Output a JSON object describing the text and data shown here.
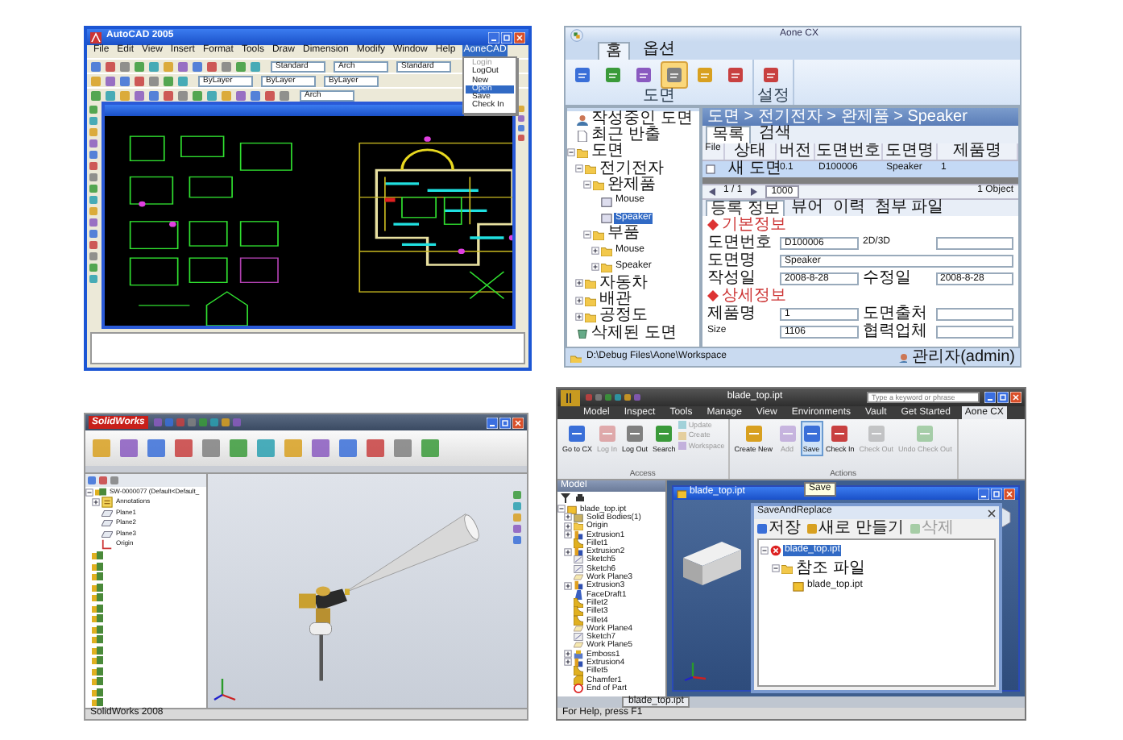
{
  "screens": [
    {
      "kind": "autocad",
      "title": "AutoCAD 2005",
      "menu": [
        {
          "label": "File",
          "selected": false
        },
        {
          "label": "Edit",
          "selected": false
        },
        {
          "label": "View",
          "selected": false
        },
        {
          "label": "Insert",
          "selected": false
        },
        {
          "label": "Format",
          "selected": false
        },
        {
          "label": "Tools",
          "selected": false
        },
        {
          "label": "Draw",
          "selected": false
        },
        {
          "label": "Dimension",
          "selected": false
        },
        {
          "label": "Modify",
          "selected": false
        },
        {
          "label": "Window",
          "selected": false
        },
        {
          "label": "Help",
          "selected": false
        },
        {
          "label": "AoneCAD",
          "selected": true
        }
      ],
      "dropdown": [
        {
          "label": "Login",
          "disabled": true,
          "selected": false
        },
        {
          "label": "LogOut",
          "disabled": false,
          "selected": false
        },
        {
          "label": "New",
          "disabled": false,
          "selected": false
        },
        {
          "label": "Open",
          "disabled": false,
          "selected": true
        },
        {
          "label": "Save",
          "disabled": false,
          "selected": false
        },
        {
          "label": "Check In",
          "disabled": false,
          "selected": false
        }
      ],
      "fields": [
        "Standard",
        "Arch",
        "Standard",
        "ByLayer",
        "ByLayer",
        "ByLayer",
        "Arch"
      ]
    },
    {
      "kind": "aone",
      "title": "Aone CX",
      "tabs": [
        {
          "label": "홈",
          "selected": true
        },
        {
          "label": "옵션",
          "selected": false
        }
      ],
      "ribbon_groups": [
        {
          "label": "도면",
          "buttons": [
            {
              "selected": false
            },
            {
              "selected": false
            },
            {
              "selected": false
            },
            {
              "selected": true
            },
            {
              "selected": false
            },
            {
              "selected": false
            }
          ]
        },
        {
          "label": "설정",
          "buttons": [
            {
              "selected": false
            }
          ]
        }
      ],
      "breadcrumb": "도면 > 전기전자 > 완제품 > Speaker",
      "tree": [
        {
          "label": "작성중인 도면",
          "kind": "user",
          "selected": false
        },
        {
          "label": "최근 반출",
          "kind": "doc",
          "selected": false
        },
        {
          "label": "도면",
          "kind": "folder",
          "selected": false,
          "expanded": true,
          "children": [
            {
              "label": "전기전자",
              "kind": "folder",
              "selected": false,
              "expanded": true,
              "children": [
                {
                  "label": "완제품",
                  "kind": "folder",
                  "selected": false,
                  "expanded": true,
                  "children": [
                    {
                      "label": "Mouse",
                      "kind": "item",
                      "selected": false
                    },
                    {
                      "label": "Speaker",
                      "kind": "item",
                      "selected": true
                    }
                  ]
                },
                {
                  "label": "부품",
                  "kind": "folder",
                  "selected": false,
                  "expanded": true,
                  "children": [
                    {
                      "label": "Mouse",
                      "kind": "folder",
                      "selected": false,
                      "expanded": false
                    },
                    {
                      "label": "Speaker",
                      "kind": "folder",
                      "selected": false,
                      "expanded": false
                    }
                  ]
                }
              ]
            },
            {
              "label": "자동차",
              "kind": "folder",
              "selected": false,
              "expanded": false
            },
            {
              "label": "배관",
              "kind": "folder",
              "selected": false,
              "expanded": false
            },
            {
              "label": "공정도",
              "kind": "folder",
              "selected": false,
              "expanded": false
            }
          ]
        },
        {
          "label": "삭제된 도면",
          "kind": "trash",
          "selected": false
        }
      ],
      "list_tabs": [
        {
          "label": "목록",
          "selected": true
        },
        {
          "label": "검색",
          "selected": false
        }
      ],
      "columns": [
        "File",
        "상태",
        "버전",
        "도면번호",
        "도면명",
        "제품명"
      ],
      "rows": [
        {
          "selected": true,
          "cells": [
            "",
            "새 도면",
            "0.1",
            "D100006",
            "Speaker",
            "1"
          ]
        }
      ],
      "pager": {
        "page": "1 / 1",
        "page_size": "1000",
        "count": "1 Object"
      },
      "detail_tabs": [
        {
          "label": "등록 정보",
          "selected": true
        },
        {
          "label": "뷰어",
          "selected": false
        },
        {
          "label": "이력",
          "selected": false
        },
        {
          "label": "첨부 파일",
          "selected": false
        }
      ],
      "sections": [
        {
          "title": "기본정보",
          "fields": [
            {
              "label": "도면번호",
              "value": "D100006"
            },
            {
              "label": "2D/3D"
            },
            {
              "label": "도면명",
              "value": "Speaker",
              "wide": true
            },
            {
              "label": "작성일",
              "value": "2008-8-28"
            },
            {
              "label": "수정일",
              "value": "2008-8-28"
            }
          ]
        },
        {
          "title": "상세정보",
          "fields": [
            {
              "label": "제품명",
              "value": "1"
            },
            {
              "label": "도면출처"
            },
            {
              "label": "Size",
              "value": "1106"
            },
            {
              "label": "협력업체"
            }
          ]
        }
      ],
      "status_path": "D:\\Debug Files\\Aone\\Workspace",
      "status_user": "관리자(admin)"
    },
    {
      "kind": "solidworks",
      "logo": "SolidWorks",
      "tree": [
        {
          "label": "SW-0000077 (Default<Default_",
          "kind": "assembly",
          "expanded": true,
          "children": [
            {
              "label": "Annotations",
              "kind": "annotations",
              "expanded": false
            },
            {
              "label": "Plane1",
              "kind": "plane"
            },
            {
              "label": "Plane2",
              "kind": "plane"
            },
            {
              "label": "Plane3",
              "kind": "plane"
            },
            {
              "label": "Origin",
              "kind": "origin"
            }
          ]
        }
      ],
      "status": "SolidWorks 2008"
    },
    {
      "kind": "inventor",
      "title": "blade_top.ipt",
      "search_placeholder": "Type a keyword or phrase",
      "tabs": [
        {
          "label": "Model",
          "selected": false
        },
        {
          "label": "Inspect",
          "selected": false
        },
        {
          "label": "Tools",
          "selected": false
        },
        {
          "label": "Manage",
          "selected": false
        },
        {
          "label": "View",
          "selected": false
        },
        {
          "label": "Environments",
          "selected": false
        },
        {
          "label": "Vault",
          "selected": false
        },
        {
          "label": "Get Started",
          "selected": false
        },
        {
          "label": "Aone CX",
          "selected": true
        }
      ],
      "ribbon_groups": [
        {
          "label": "Access",
          "buttons": [
            {
              "label": "Go to CX",
              "kind": "large",
              "disabled": false,
              "selected": false
            },
            {
              "label": "Log In",
              "kind": "large",
              "disabled": true,
              "selected": false
            },
            {
              "label": "Log Out",
              "kind": "large",
              "disabled": false,
              "selected": false
            },
            {
              "label": "Search",
              "kind": "large",
              "disabled": false,
              "selected": false
            },
            {
              "label": "Update",
              "kind": "small",
              "disabled": true,
              "selected": false
            },
            {
              "label": "Create",
              "kind": "small",
              "disabled": true,
              "selected": false
            },
            {
              "label": "Workspace",
              "kind": "small",
              "disabled": true,
              "selected": false
            }
          ]
        },
        {
          "label": "Actions",
          "buttons": [
            {
              "label": "Create New",
              "kind": "large",
              "disabled": false,
              "selected": false
            },
            {
              "label": "Add",
              "kind": "large",
              "disabled": true,
              "selected": false
            },
            {
              "label": "Save",
              "kind": "large",
              "disabled": false,
              "selected": true
            },
            {
              "label": "Check In",
              "kind": "large",
              "disabled": false,
              "selected": false
            },
            {
              "label": "Check Out",
              "kind": "large",
              "disabled": true,
              "selected": false
            },
            {
              "label": "Undo Check Out",
              "kind": "large",
              "disabled": true,
              "selected": false
            }
          ]
        }
      ],
      "tooltip": "Save",
      "browser_title": "Model",
      "browser": [
        {
          "label": "blade_top.ipt",
          "kind": "part",
          "expanded": true,
          "children": [
            {
              "label": "Solid Bodies(1)",
              "kind": "bodies",
              "expanded": false
            },
            {
              "label": "Origin",
              "kind": "folder",
              "expanded": false
            },
            {
              "label": "Extrusion1",
              "kind": "extrude",
              "expanded": false
            },
            {
              "label": "Fillet1",
              "kind": "fillet"
            },
            {
              "label": "Extrusion2",
              "kind": "extrude",
              "expanded": false
            },
            {
              "label": "Sketch5",
              "kind": "sketch"
            },
            {
              "label": "Sketch6",
              "kind": "sketch"
            },
            {
              "label": "Work Plane3",
              "kind": "workplane"
            },
            {
              "label": "Extrusion3",
              "kind": "extrude",
              "expanded": false
            },
            {
              "label": "FaceDraft1",
              "kind": "draft"
            },
            {
              "label": "Fillet2",
              "kind": "fillet"
            },
            {
              "label": "Fillet3",
              "kind": "fillet"
            },
            {
              "label": "Fillet4",
              "kind": "fillet"
            },
            {
              "label": "Work Plane4",
              "kind": "workplane"
            },
            {
              "label": "Sketch7",
              "kind": "sketch"
            },
            {
              "label": "Work Plane5",
              "kind": "workplane"
            },
            {
              "label": "Emboss1",
              "kind": "emboss",
              "expanded": false
            },
            {
              "label": "Extrusion4",
              "kind": "extrude",
              "expanded": false
            },
            {
              "label": "Fillet5",
              "kind": "fillet"
            },
            {
              "label": "Chamfer1",
              "kind": "chamfer"
            },
            {
              "label": "End of Part",
              "kind": "end"
            }
          ]
        }
      ],
      "document_title": "blade_top.ipt",
      "dialog": {
        "title": "SaveAndReplace",
        "tools": [
          {
            "label": "저장",
            "disabled": false
          },
          {
            "label": "새로 만들기",
            "disabled": false
          },
          {
            "label": "삭제",
            "disabled": true
          }
        ],
        "tree": [
          {
            "label": "blade_top.ipt",
            "kind": "error",
            "selected": true,
            "expanded": true,
            "children": [
              {
                "label": "참조 파일",
                "kind": "folder",
                "selected": false,
                "expanded": true,
                "children": [
                  {
                    "label": "blade_top.ipt",
                    "kind": "part",
                    "selected": false
                  }
                ]
              }
            ]
          }
        ]
      },
      "doc_tab": "blade_top.ipt",
      "status": "For Help, press F1"
    }
  ]
}
